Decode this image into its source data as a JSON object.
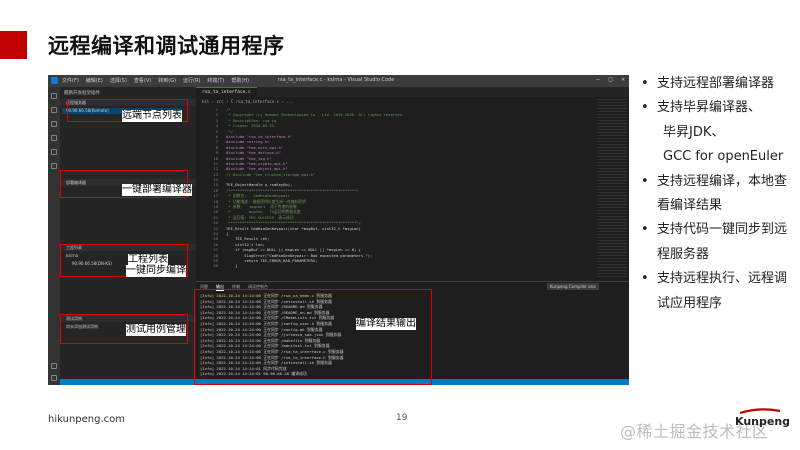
{
  "slide": {
    "title": "远程编译和调试通用程序",
    "footer_url": "hikunpeng.com",
    "page_number": "19",
    "logo_text": "Kunpeng",
    "watermark": "@稀土掘金技术社区",
    "accent_color": "#c00000"
  },
  "ide": {
    "window_title": "rsa_ta_interface.c - kslrna - Visual Studio Code",
    "menu": [
      "文件(F)",
      "编辑(E)",
      "选择(S)",
      "查看(V)",
      "转到(G)",
      "运行(R)",
      "终端(T)",
      "帮助(H)"
    ],
    "sidebar": {
      "header": "鲲鹏开发框架插件",
      "sections": [
        {
          "label": "远程服务器",
          "rows": [
            "90.90.66.58(Remote)"
          ]
        },
        {
          "label": "部署编译器",
          "rows": []
        },
        {
          "label": "工程列表",
          "rows": [
            "kslrna",
            "90.90.66.58(DN-KS)"
          ]
        },
        {
          "label": "测试用例",
          "rows": [
            "尚未添加测试用例"
          ]
        }
      ]
    },
    "tab_label": "rsa_ta_interface.c",
    "breadcrumb": "ksl › src › C rsa_ta_interface.c › ...",
    "code_lines": [
      {
        "n": "1",
        "t": "/*",
        "c": "com"
      },
      {
        "n": "2",
        "t": " * Copyright (c) Huawei Technologies Co., Ltd. 2019-2020. All rights reserved.",
        "c": "com"
      },
      {
        "n": "3",
        "t": " * Description: rsa ta",
        "c": "com"
      },
      {
        "n": "4",
        "t": " * Create: 2020-09-21",
        "c": "com"
      },
      {
        "n": "5",
        "t": " */",
        "c": "com"
      },
      {
        "n": "6",
        "t": "#include \"rsa_ta_interface.h\"",
        "c": "pre"
      },
      {
        "n": "7",
        "t": "#include <string.h>",
        "c": "pre"
      },
      {
        "n": "8",
        "t": "#include \"tee_core_api.h\"",
        "c": "pre"
      },
      {
        "n": "9",
        "t": "#include \"tee_defines.h\"",
        "c": "pre"
      },
      {
        "n": "10",
        "t": "#include \"tee_log.h\"",
        "c": "pre"
      },
      {
        "n": "11",
        "t": "#include \"tee_crypto_api.h\"",
        "c": "pre"
      },
      {
        "n": "12",
        "t": "#include \"tee_object_api.h\"",
        "c": "pre"
      },
      {
        "n": "13",
        "t": "// #include \"tee_trusted_storage_api.h\"",
        "c": "com"
      },
      {
        "n": "14",
        "t": "",
        "c": "def"
      },
      {
        "n": "15",
        "t": "TEE_ObjectHandle g_rsaKeyObj;",
        "c": "def"
      },
      {
        "n": "16",
        "t": "/*********************************************************",
        "c": "com"
      },
      {
        "n": "17",
        "t": " * 函数名:   CmdRsaGenKeypair",
        "c": "com"
      },
      {
        "n": "18",
        "t": " * 功能描述: 根据密钥长度生成一对随机密钥",
        "c": "com"
      },
      {
        "n": "19",
        "t": " * 参数:   msgHer1  用于传递的参数",
        "c": "com"
      },
      {
        "n": "20",
        "t": " *        msgCon   TA返回的数据长度",
        "c": "com"
      },
      {
        "n": "21",
        "t": " * 返回值: TEE_SUCCESS  表示成功",
        "c": "com"
      },
      {
        "n": "22",
        "t": " *********************************************************/",
        "c": "com"
      },
      {
        "n": "23",
        "t": "TEE_Result CmdRsaGenKeypair(char *msgBuf, uint32_t *msgLen)",
        "c": "def"
      },
      {
        "n": "24",
        "t": "{",
        "c": "def"
      },
      {
        "n": "25",
        "t": "    TEE_Result ret;",
        "c": "def"
      },
      {
        "n": "26",
        "t": "    uint32_t len;",
        "c": "def"
      },
      {
        "n": "27",
        "t": "    if (msgBuf == NULL || msgLen == NULL || *msgLen == 0) {",
        "c": "def"
      },
      {
        "n": "28",
        "t": "        SLogError(\"CmdRsaGenKeypair: Bad expected parameters.\");",
        "c": "def"
      },
      {
        "n": "29",
        "t": "        return TEE_ERROR_BAD_PARAMETERS;",
        "c": "def"
      },
      {
        "n": "30",
        "t": "    }",
        "c": "def"
      }
    ],
    "panel_tabs": [
      "问题",
      "输出",
      "终端",
      "调试控制台"
    ],
    "panel_active": "输出",
    "panel_dropdown": "Kunpeng Compiler ana",
    "log_lines": [
      "[Info]  2022-10-24 14:24:00  正在同步 /rsa_ca_demo.c 到服务器",
      "[Info]  2022-10-24 14:24:00  正在同步 /setinstall.sh 到服务器",
      "[Info]  2022-10-24 14:24:00  正在同步 /README.md 到服务器",
      "[Info]  2022-10-24 14:24:00  正在同步 /README_en.md 到服务器",
      "[Info]  2022-10-24 14:24:00  正在同步 /CMakeLists.txt 到服务器",
      "[Info]  2022-10-24 14:24:00  正在同步 /config_user.h 到服务器",
      "[Info]  2022-10-24 14:24:00  正在同步 /config.mk 到服务器",
      "[Info]  2022-10-24 14:24:00  正在同步 /jsrsasia_saa.json 到服务器",
      "[Info]  2022-10-24 14:24:00  正在同步 /makefile 到服务器",
      "[Info]  2022-10-24 14:24:00  正在同步 /manifest.txt 到服务器",
      "[Info]  2022-10-24 14:24:00  正在同步 /rsa_ta_interface.c 到服务器",
      "[Info]  2022-10-24 14:24:00  正在同步 /rsa_ta_interface.h 到服务器",
      "[Info]  2022-10-24 14:24:00  正在同步 /setinstall.sh 到服务器",
      "[Info]  2022-10-24 14:24:01  同步代码完成",
      "[Info]  2022-10-24 14:24:01  90.90.66.58 编译成功"
    ]
  },
  "annotations": {
    "remote_nodes": "远端节点列表",
    "deploy_compiler": "一键部署编译器",
    "project_list_line1": "工程列表",
    "project_list_line2": "一键同步编译",
    "test_cases": "测试用例管理",
    "compile_output": "编译结果输出"
  },
  "bullets": [
    {
      "text": "支持远程部署编译器",
      "sub": []
    },
    {
      "text": "支持毕昇编译器、",
      "sub": [
        "毕昇JDK、",
        "GCC for openEuler"
      ]
    },
    {
      "text": "支持远程编译，本地查看编译结果",
      "sub": []
    },
    {
      "text": "支持代码一键同步到远程服务器",
      "sub": []
    },
    {
      "text": "支持远程执行、远程调试应用程序",
      "sub": []
    }
  ]
}
